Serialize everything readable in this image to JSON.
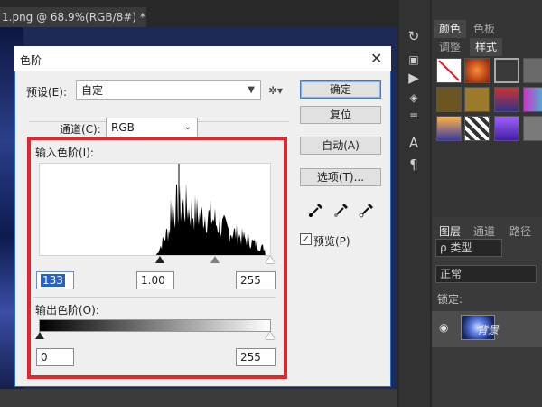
{
  "document_tab": {
    "title": "1.png @ 68.9%(RGB/8#) *",
    "close": "×"
  },
  "right_panel": {
    "tabs_top": [
      "颜色",
      "色板"
    ],
    "tabs_second": [
      "调整",
      "样式"
    ],
    "layer_tabs": [
      "图层",
      "通道",
      "路径"
    ],
    "kind_filter": "ρ 类型",
    "blend_mode": "正常",
    "lock_label": "锁定:",
    "layer_name": "背景"
  },
  "dialog": {
    "title": "色阶",
    "close": "✕",
    "preset_label": "预设(E):",
    "preset_value": "自定",
    "channel_label": "通道(C):",
    "channel_value": "RGB",
    "input_levels_label": "输入色阶(I):",
    "input_black": "133",
    "input_gamma": "1.00",
    "input_white": "255",
    "output_levels_label": "输出色阶(O):",
    "output_black": "0",
    "output_white": "255",
    "buttons": {
      "ok": "确定",
      "reset": "复位",
      "auto": "自动(A)",
      "options": "选项(T)..."
    },
    "preview_label": "预览(P)",
    "preview_checked": true
  },
  "colors": {
    "highlight": "#e0272e",
    "accent": "#2b6cc4"
  }
}
